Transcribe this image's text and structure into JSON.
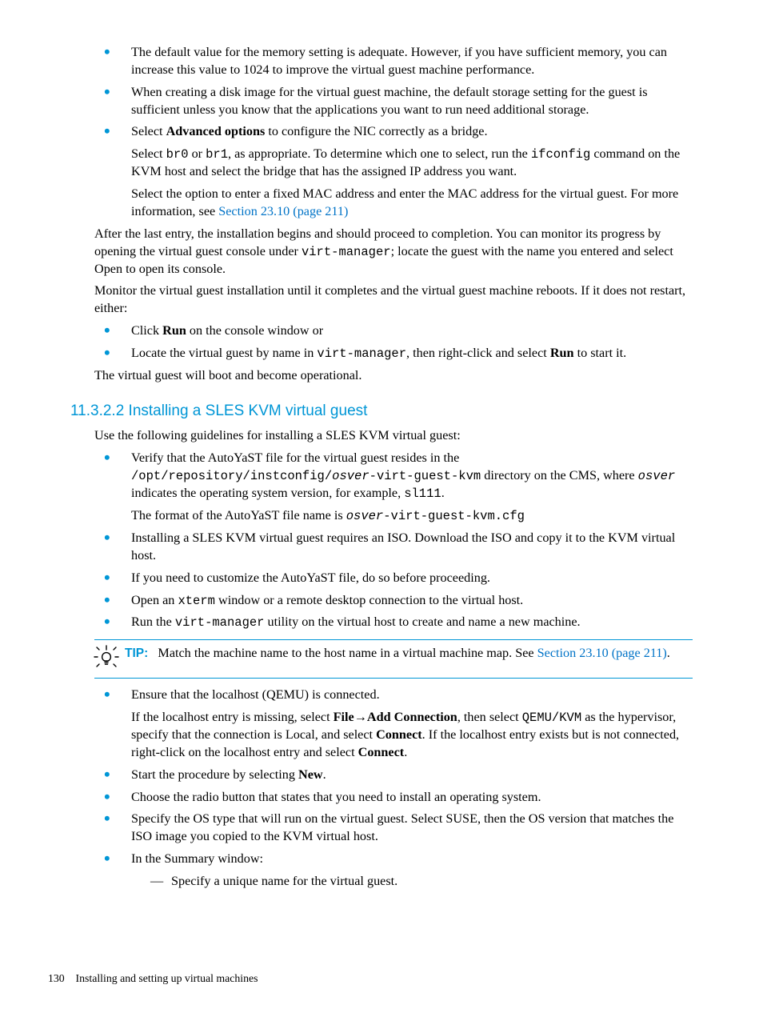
{
  "top_bullets": {
    "b1": "The default value for the memory setting is adequate. However, if you have sufficient memory, you can increase this value to 1024 to improve the virtual guest machine performance.",
    "b2": "When creating a disk image for the virtual guest machine, the default storage setting for the guest is sufficient unless you know that the applications you want to run need additional storage.",
    "b3_pre": "Select ",
    "b3_bold": "Advanced options",
    "b3_post": " to configure the NIC correctly as a bridge.",
    "b3_p2_a": "Select ",
    "b3_p2_code1": "br0",
    "b3_p2_b": " or ",
    "b3_p2_code2": "br1",
    "b3_p2_c": ", as appropriate. To determine which one to select, run the ",
    "b3_p2_code3": "ifconfig",
    "b3_p2_d": " command on the KVM host and select the bridge that has the assigned IP address you want.",
    "b3_p3_a": "Select the option to enter a fixed MAC address and enter the MAC address for the virtual guest. For more information, see ",
    "b3_p3_link": "Section 23.10 (page 211)"
  },
  "mid": {
    "p1_a": "After the last entry, the installation begins and should proceed to completion. You can monitor its progress by opening the virtual guest console under ",
    "p1_code": "virt-manager",
    "p1_b": "; locate the guest with the name you entered and select Open to open its console.",
    "p2": "Monitor the virtual guest installation until it completes and the virtual guest machine reboots. If it does not restart, either:",
    "b1_a": "Click ",
    "b1_bold": "Run",
    "b1_b": " on the console window or",
    "b2_a": "Locate the virtual guest by name in ",
    "b2_code": "virt-manager",
    "b2_b": ", then right-click and select ",
    "b2_bold": "Run",
    "b2_c": " to start it.",
    "p3": "The virtual guest will boot and become operational."
  },
  "heading": "11.3.2.2 Installing a SLES KVM virtual guest",
  "sles": {
    "intro": "Use the following guidelines for installing a SLES KVM virtual guest:",
    "b1_a": "Verify that the AutoYaST file for the virtual guest resides in the ",
    "b1_code1": "/opt/repository/instconfig/",
    "b1_italic1": "osver",
    "b1_code2": "-virt-guest-kvm",
    "b1_b": " directory on the CMS, where ",
    "b1_italic2": "osver",
    "b1_c": " indicates the operating system version, for example, ",
    "b1_code3": "sl111",
    "b1_d": ".",
    "b1_p2_a": "The format of the AutoYaST file name is ",
    "b1_p2_italic": "osver",
    "b1_p2_code": "-virt-guest-kvm.cfg",
    "b2": "Installing a SLES KVM virtual guest requires an ISO. Download the ISO and copy it to the KVM virtual host.",
    "b3": "If you need to customize the AutoYaST file, do so before proceeding.",
    "b4_a": "Open an ",
    "b4_code": "xterm",
    "b4_b": " window or a remote desktop connection to the virtual host.",
    "b5_a": "Run the ",
    "b5_code": "virt-manager",
    "b5_b": " utility on the virtual host to create and name a new machine."
  },
  "tip": {
    "label": "TIP:",
    "text_a": "Match the machine name to the host name in a virtual machine map. See ",
    "link": "Section 23.10 (page 211)",
    "text_b": "."
  },
  "sles2": {
    "b6_a": "Ensure that the localhost (QEMU) is connected.",
    "b6_p2_a": "If the localhost entry is missing, select ",
    "b6_p2_bold1": "File",
    "b6_p2_arrow": "→",
    "b6_p2_bold2": "Add Connection",
    "b6_p2_b": ", then select ",
    "b6_p2_code": "QEMU/KVM",
    "b6_p2_c": " as the hypervisor, specify that the connection is Local, and select ",
    "b6_p2_bold3": "Connect",
    "b6_p2_d": ". If the localhost entry exists but is not connected, right-click on the localhost entry and select ",
    "b6_p2_bold4": "Connect",
    "b6_p2_e": ".",
    "b7_a": "Start the procedure by selecting ",
    "b7_bold": "New",
    "b7_b": ".",
    "b8": "Choose the radio button that states that you need to install an operating system.",
    "b9": "Specify the OS type that will run on the virtual guest. Select SUSE, then the OS version that matches the ISO image you copied to the KVM virtual host.",
    "b10": "In the Summary window:",
    "b10_dash1": "Specify a unique name for the virtual guest."
  },
  "footer": {
    "page": "130",
    "title": "Installing and setting up virtual machines"
  }
}
